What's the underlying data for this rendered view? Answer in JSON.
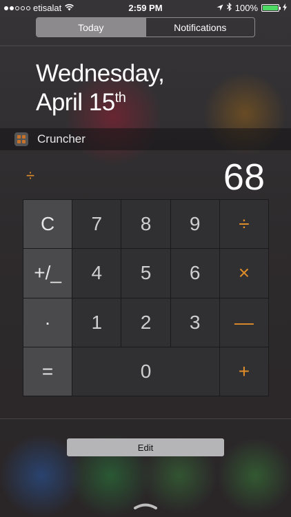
{
  "status_bar": {
    "signal_dots": [
      true,
      true,
      false,
      false,
      false
    ],
    "carrier": "etisalat",
    "time": "2:59 PM",
    "battery_percent": "100%",
    "battery_level": 1.0,
    "icons": [
      "wifi-icon",
      "location-arrow-icon",
      "bluetooth-icon",
      "battery-icon",
      "charging-bolt-icon"
    ]
  },
  "tabs": [
    {
      "label": "Today",
      "selected": true
    },
    {
      "label": "Notifications",
      "selected": false
    }
  ],
  "date": {
    "weekday": "Wednesday,",
    "month_day": "April 15",
    "ordinal_suffix": "th"
  },
  "widget": {
    "app_name": "Cruncher",
    "icon": "cruncher-app-icon",
    "pending_operator": "÷",
    "display_value": "68",
    "keys": [
      {
        "label": "C",
        "kind": "fn"
      },
      {
        "label": "7",
        "kind": "num"
      },
      {
        "label": "8",
        "kind": "num"
      },
      {
        "label": "9",
        "kind": "num"
      },
      {
        "label": "÷",
        "kind": "op"
      },
      {
        "label": "+/_",
        "kind": "fn"
      },
      {
        "label": "4",
        "kind": "num"
      },
      {
        "label": "5",
        "kind": "num"
      },
      {
        "label": "6",
        "kind": "num"
      },
      {
        "label": "×",
        "kind": "op"
      },
      {
        "label": "·",
        "kind": "fn"
      },
      {
        "label": "1",
        "kind": "num"
      },
      {
        "label": "2",
        "kind": "num"
      },
      {
        "label": "3",
        "kind": "num"
      },
      {
        "label": "—",
        "kind": "op"
      },
      {
        "label": "=",
        "kind": "fn"
      },
      {
        "label": "0",
        "kind": "num"
      },
      {
        "label": "+",
        "kind": "op"
      }
    ]
  },
  "footer": {
    "edit_label": "Edit",
    "grabber_icon": "chevron-grabber-icon"
  },
  "colors": {
    "accent_operator": "#e08e2a",
    "battery_fill": "#4cd964",
    "selected_tab_bg": "#8c8a8d"
  }
}
